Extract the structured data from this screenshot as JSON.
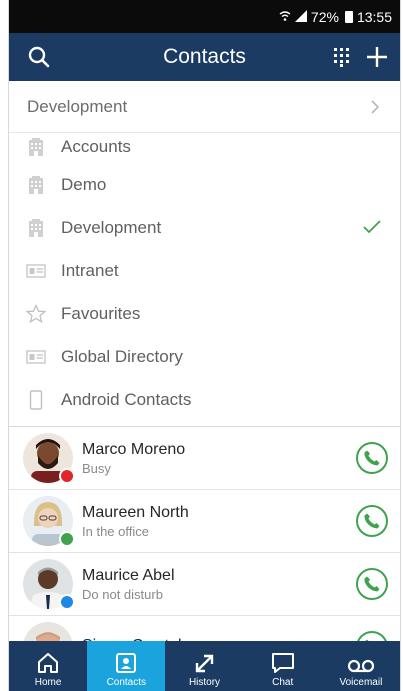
{
  "status": {
    "battery": "72%",
    "time": "13:55"
  },
  "header": {
    "title": "Contacts"
  },
  "selector": {
    "label": "Development"
  },
  "directories": [
    {
      "label": "Accounts",
      "icon": "building-icon"
    },
    {
      "label": "Demo",
      "icon": "building-icon"
    },
    {
      "label": "Development",
      "icon": "building-icon",
      "selected": true
    },
    {
      "label": "Intranet",
      "icon": "id-card-icon"
    },
    {
      "label": "Favourites",
      "icon": "star-icon"
    },
    {
      "label": "Global Directory",
      "icon": "id-card-icon"
    },
    {
      "label": "Android Contacts",
      "icon": "phone-device-icon"
    }
  ],
  "contacts": [
    {
      "name": "Marco Moreno",
      "status": "Busy",
      "presence_color": "#e0262b"
    },
    {
      "name": "Maureen North",
      "status": "In the office",
      "presence_color": "#3fa34d"
    },
    {
      "name": "Maurice Abel",
      "status": "Do not disturb",
      "presence_color": "#1e88e5"
    },
    {
      "name": "Simon Crystal",
      "status": "",
      "presence_color": ""
    }
  ],
  "tabs": [
    {
      "label": "Home",
      "icon": "home-icon"
    },
    {
      "label": "Contacts",
      "icon": "contacts-icon",
      "active": true
    },
    {
      "label": "History",
      "icon": "history-icon"
    },
    {
      "label": "Chat",
      "icon": "chat-icon"
    },
    {
      "label": "Voicemail",
      "icon": "voicemail-icon"
    }
  ],
  "colors": {
    "header": "#1b3b63",
    "active_tab": "#1aa3dd",
    "call": "#3fa34d",
    "check": "#3fa34d"
  }
}
